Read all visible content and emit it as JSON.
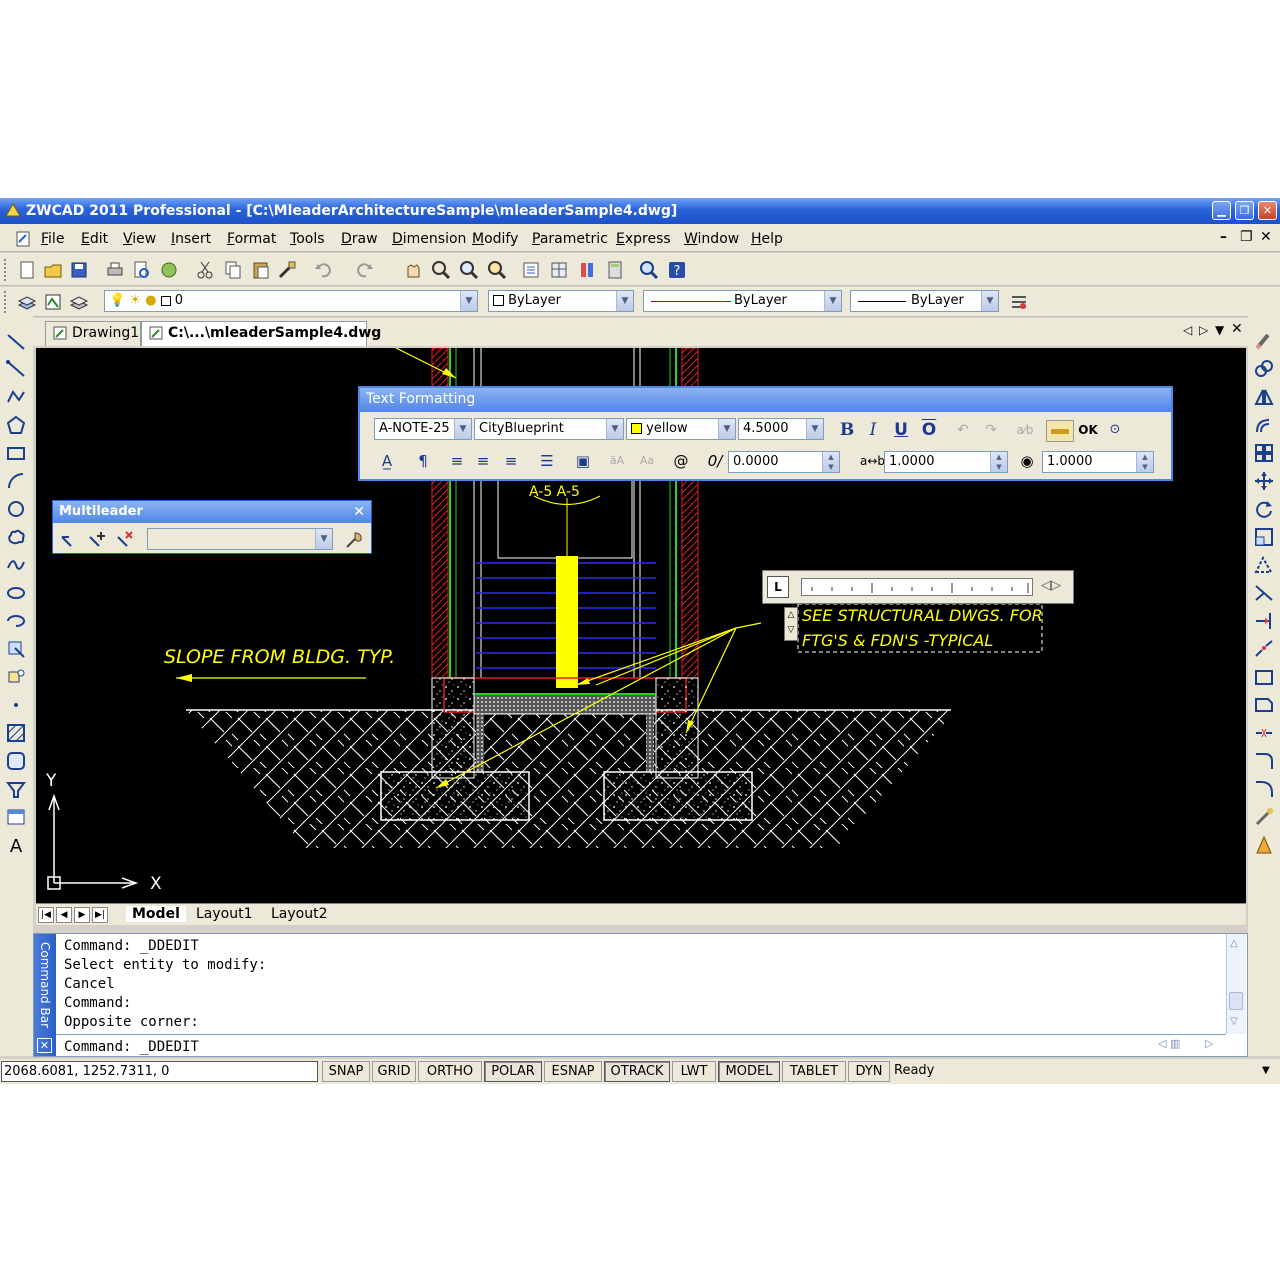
{
  "window": {
    "title": "ZWCAD 2011 Professional - [C:\\MleaderArchitectureSample\\mleaderSample4.dwg]"
  },
  "menu": [
    "File",
    "Edit",
    "View",
    "Insert",
    "Format",
    "Tools",
    "Draw",
    "Dimension",
    "Modify",
    "Parametric",
    "Express",
    "Window",
    "Help"
  ],
  "properties": {
    "layer": "0",
    "color": "ByLayer",
    "linetype": "ByLayer",
    "lineweight": "ByLayer"
  },
  "doc_tabs": [
    "Drawing1",
    "C:\\...\\mleaderSample4.dwg"
  ],
  "text_formatting": {
    "title": "Text Formatting",
    "style": "A-NOTE-25",
    "font": "CityBlueprint",
    "color": "yellow",
    "height": "4.5000",
    "ok": "OK",
    "oblique": "0.0000",
    "tracking": "1.0000",
    "width": "1.0000"
  },
  "multileader": {
    "title": "Multileader"
  },
  "drawing": {
    "note_slope": "SLOPE FROM BLDG. TYP.",
    "note_line1": "SEE STRUCTURAL DWGS. FOR",
    "note_line2": "FTG'S & FDN'S -TYPICAL",
    "section_tag": "A-5 A-5",
    "axis_x": "X",
    "axis_y": "Y"
  },
  "layout_tabs": [
    "Model",
    "Layout1",
    "Layout2"
  ],
  "command_bar": {
    "label": "Command Bar",
    "history": [
      "Command: _DDEDIT",
      "Select entity to modify:",
      "Cancel",
      "Command:",
      "Opposite corner:"
    ],
    "prompt": "Command: _DDEDIT"
  },
  "status": {
    "coords": "2068.6081, 1252.7311, 0",
    "buttons": [
      {
        "label": "SNAP",
        "on": false
      },
      {
        "label": "GRID",
        "on": false
      },
      {
        "label": "ORTHO",
        "on": false
      },
      {
        "label": "POLAR",
        "on": true
      },
      {
        "label": "ESNAP",
        "on": false
      },
      {
        "label": "OTRACK",
        "on": true
      },
      {
        "label": "LWT",
        "on": false
      },
      {
        "label": "MODEL",
        "on": true
      },
      {
        "label": "TABLET",
        "on": false
      },
      {
        "label": "DYN",
        "on": false
      }
    ],
    "ready": "Ready"
  },
  "colors": {
    "accent": "#2a62d8",
    "canvas": "#000000",
    "annotation": "#ffff00"
  }
}
